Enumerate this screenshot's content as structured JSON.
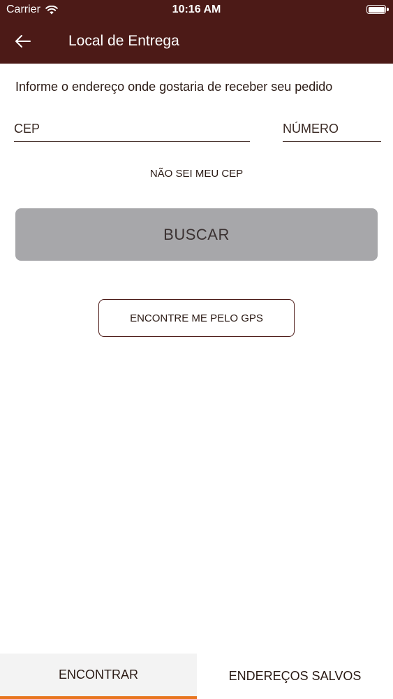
{
  "statusbar": {
    "carrier": "Carrier",
    "time": "10:16 AM"
  },
  "header": {
    "title": "Local de Entrega",
    "back_icon": "arrow-left-icon"
  },
  "form": {
    "instruction": "Informe o endereço onde gostaria de receber seu pedido",
    "cep_placeholder": "CEP",
    "numero_placeholder": "NÚMERO",
    "cep_unknown_link": "NÃO SEI MEU CEP",
    "search_button": "BUSCAR",
    "gps_button": "ENCONTRE ME PELO GPS"
  },
  "tabs": [
    {
      "label": "ENCONTRAR",
      "active": true
    },
    {
      "label": "ENDEREÇOS SALVOS",
      "active": false
    }
  ],
  "colors": {
    "header_bg": "#4c1a17",
    "tab_indicator": "#e8751f",
    "disabled_button": "#a7a7aa"
  }
}
